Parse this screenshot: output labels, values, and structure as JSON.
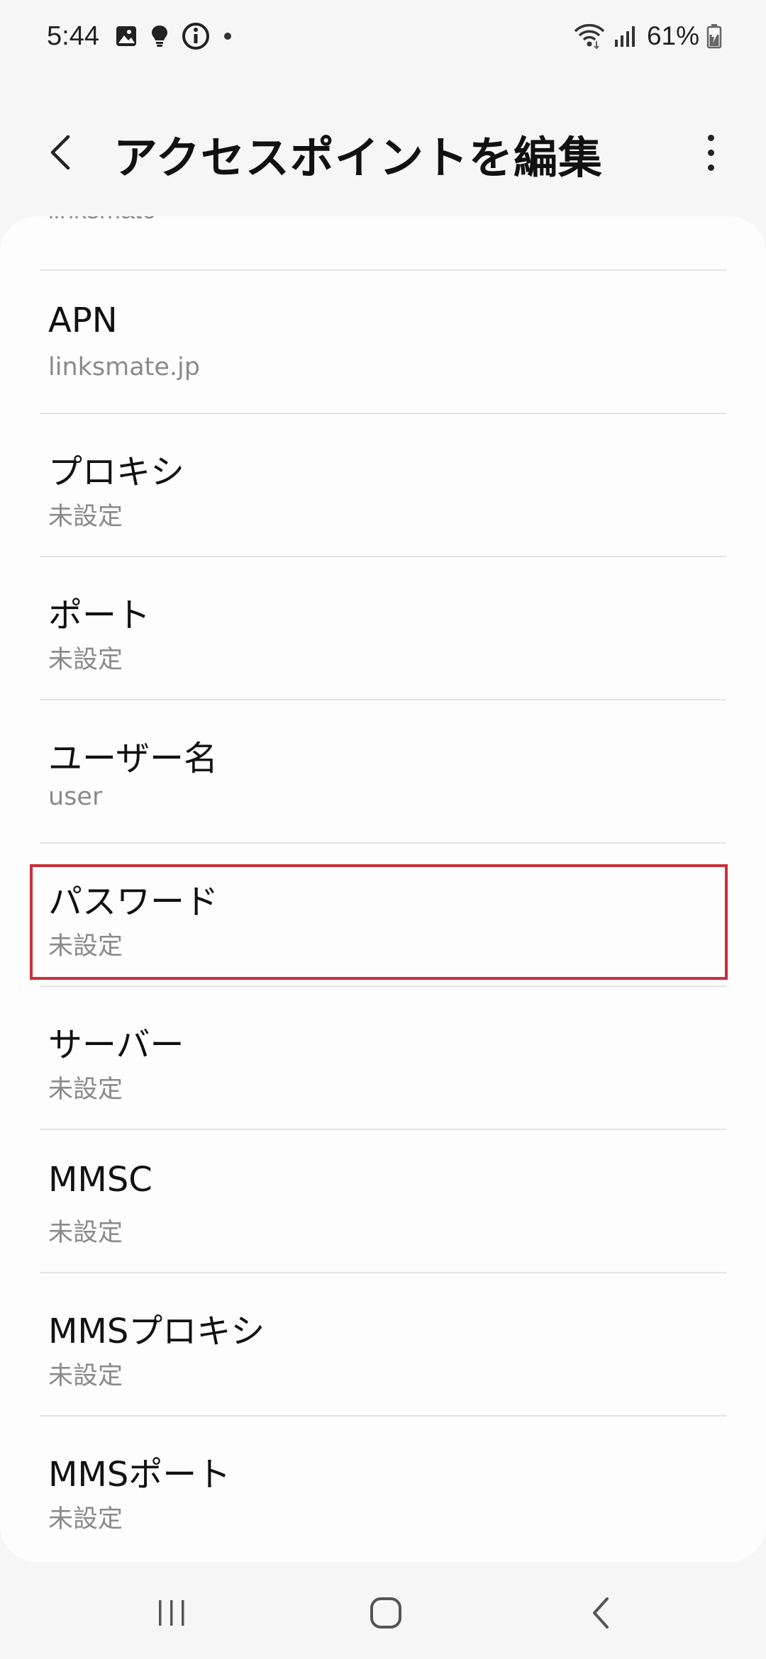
{
  "status_bar": {
    "time": "5:44",
    "battery": "61%",
    "icons": [
      "gallery-icon",
      "bulb-icon",
      "info-icon",
      "dot-icon",
      "wifi-icon",
      "signal-icon",
      "battery-icon"
    ]
  },
  "header": {
    "title": "アクセスポイントを編集"
  },
  "partial_item": {
    "value": "linksmate"
  },
  "items": [
    {
      "label": "APN",
      "value": "linksmate.jp"
    },
    {
      "label": "プロキシ",
      "value": "未設定"
    },
    {
      "label": "ポート",
      "value": "未設定"
    },
    {
      "label": "ユーザー名",
      "value": "user"
    },
    {
      "label": "パスワード",
      "value": "未設定"
    },
    {
      "label": "サーバー",
      "value": "未設定"
    },
    {
      "label": "MMSC",
      "value": "未設定"
    },
    {
      "label": "MMSプロキシ",
      "value": "未設定"
    },
    {
      "label": "MMSポート",
      "value": "未設定"
    }
  ],
  "colors": {
    "background": "#f6f6f6",
    "card": "#fdfdfd",
    "highlight": "#c8303a",
    "secondary_text": "#8a8a8a"
  }
}
